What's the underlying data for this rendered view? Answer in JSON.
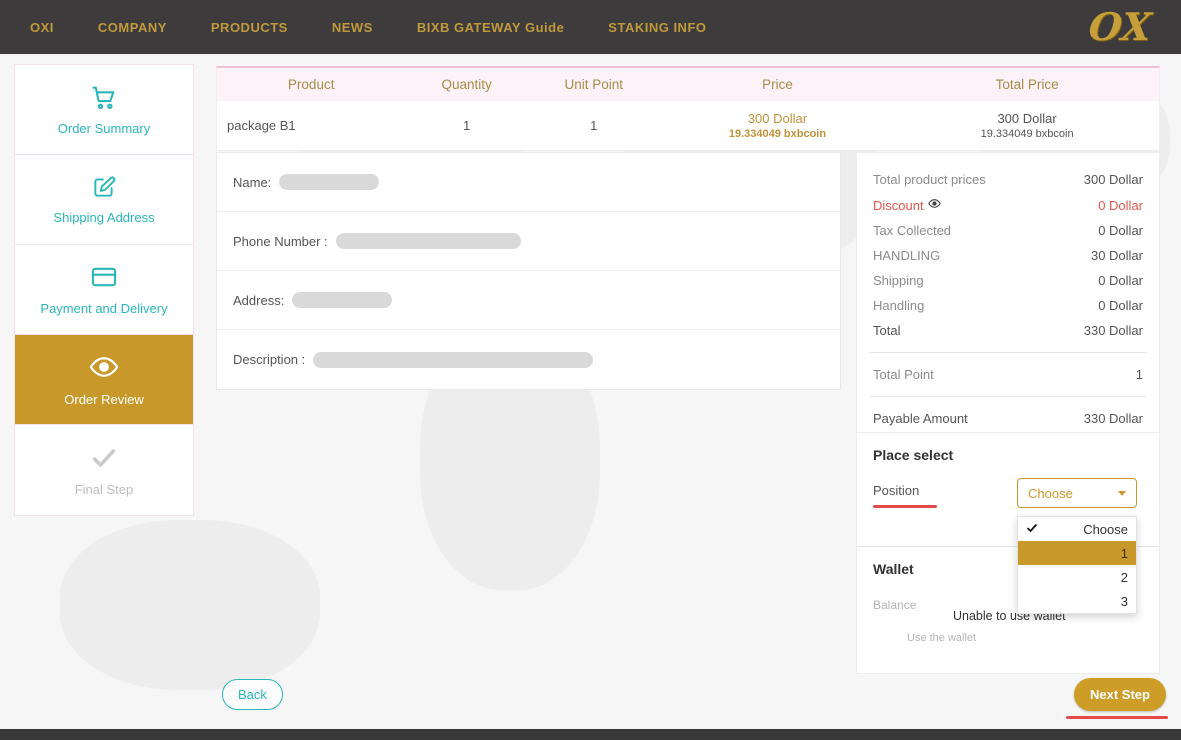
{
  "nav": {
    "items": [
      "OXI",
      "COMPANY",
      "PRODUCTS",
      "NEWS",
      "BIXB GATEWAY Guide",
      "STAKING INFO"
    ],
    "logo": "OX"
  },
  "sidebar": {
    "steps": [
      {
        "label": "Order Summary",
        "icon": "cart-icon",
        "state": "done"
      },
      {
        "label": "Shipping Address",
        "icon": "edit-icon",
        "state": "done"
      },
      {
        "label": "Payment and Delivery",
        "icon": "credit-card-icon",
        "state": "done"
      },
      {
        "label": "Order Review",
        "icon": "eye-icon",
        "state": "active"
      },
      {
        "label": "Final Step",
        "icon": "check-icon",
        "state": "upcoming"
      }
    ]
  },
  "order_table": {
    "headers": [
      "Product",
      "Quantity",
      "Unit Point",
      "Price",
      "Total Price"
    ],
    "rows": [
      {
        "product": "package B1",
        "quantity": "1",
        "unit_point": "1",
        "price_dollar": "300 Dollar",
        "price_coin": "19.334049 bxbcoin",
        "total_dollar": "300 Dollar",
        "total_coin": "19.334049 bxbcoin"
      }
    ]
  },
  "review_form": {
    "fields": [
      {
        "label": "Name:"
      },
      {
        "label": "Phone Number :"
      },
      {
        "label": "Address:"
      },
      {
        "label": "Description :"
      }
    ]
  },
  "summary": {
    "rows": [
      {
        "label": "Total product prices",
        "value": "300 Dollar"
      },
      {
        "label": "Discount",
        "value": "0 Dollar"
      },
      {
        "label": "Tax Collected",
        "value": "0 Dollar"
      },
      {
        "label": "HANDLING",
        "value": "30 Dollar"
      },
      {
        "label": "Shipping",
        "value": "0 Dollar"
      },
      {
        "label": "Handling",
        "value": "0 Dollar"
      },
      {
        "label": "Total",
        "value": "330 Dollar"
      }
    ],
    "total_point": {
      "label": "Total Point",
      "value": "1"
    },
    "payable": {
      "label": "Payable Amount",
      "value": "330 Dollar"
    }
  },
  "place_select": {
    "title": "Place select",
    "position_label": "Position",
    "dropdown_value": "Choose",
    "options": [
      "Choose",
      "1",
      "2",
      "3"
    ],
    "selected_option": "Choose",
    "highlighted_option": "1"
  },
  "wallet": {
    "title": "Wallet",
    "balance_label": "Balance",
    "unable_text": "Unable to use wallet",
    "use_wallet_label": "Use the wallet"
  },
  "actions": {
    "back": "Back",
    "next": "Next Step"
  },
  "colors": {
    "gold": "#c8992a",
    "teal": "#2ab7b9",
    "red": "#e14b4b",
    "nav_bg": "#3d3b3b",
    "pink_header": "#fcf2f7"
  }
}
